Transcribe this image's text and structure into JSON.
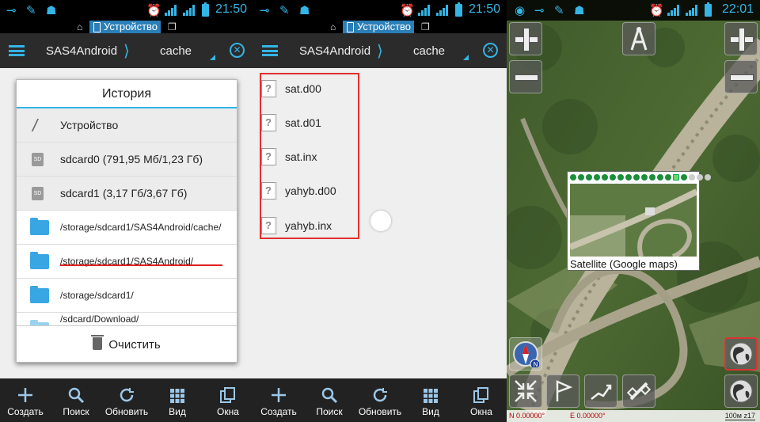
{
  "status_bar": {
    "left_panel_time": "21:50",
    "middle_panel_time": "21:50",
    "right_panel_time": "22:01",
    "device_chip": "Устройство"
  },
  "action_bar": {
    "title": "SAS4Android",
    "separator": "⟩",
    "folder": "cache"
  },
  "history_dialog": {
    "title": "История",
    "items": [
      {
        "icon": "slash",
        "label": "Устройство"
      },
      {
        "icon": "sd",
        "label": "sdcard0 (791,95 Мб/1,23 Гб)"
      },
      {
        "icon": "sd",
        "label": "sdcard1 (3,17 Гб/3,67 Гб)"
      },
      {
        "icon": "folder",
        "label": "/storage/sdcard1/SAS4Android/cache/"
      },
      {
        "icon": "folder",
        "label": "/storage/sdcard1/SAS4Android/"
      },
      {
        "icon": "folder",
        "label": "/storage/sdcard1/"
      },
      {
        "icon": "folder",
        "label": "/sdcard/Download/"
      }
    ],
    "clear_label": "Очистить"
  },
  "files": [
    "sat.d00",
    "sat.d01",
    "sat.inx",
    "yahyb.d00",
    "yahyb.inx"
  ],
  "bottom_bar": [
    {
      "icon": "plus-icon",
      "label": "Создать"
    },
    {
      "icon": "search-icon",
      "label": "Поиск"
    },
    {
      "icon": "refresh-icon",
      "label": "Обновить"
    },
    {
      "icon": "grid-icon",
      "label": "Вид"
    },
    {
      "icon": "windows-icon",
      "label": "Окна"
    }
  ],
  "map": {
    "layer_caption": "Satellite (Google maps)",
    "coord_lat": "N 0.00000°",
    "coord_lon": "E 0.00000°",
    "scale": "100м z17"
  },
  "colors": {
    "accent": "#33b5e5",
    "highlight_border": "#e03030",
    "folder": "#38a6e2"
  }
}
